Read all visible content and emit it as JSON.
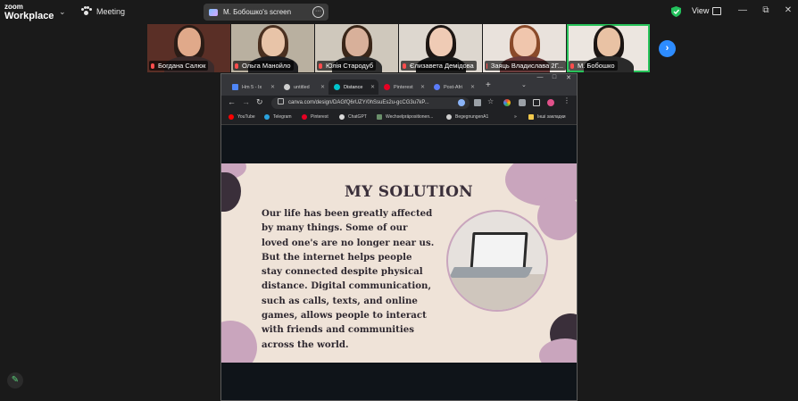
{
  "app": {
    "brand_top": "zoom",
    "brand_bottom": "Workplace",
    "meeting_label": "Meeting",
    "share_label": "M. Бобошко's screen",
    "view_label": "View"
  },
  "participants": [
    {
      "name": "Богдана Салюк",
      "skin": "#e0a98a",
      "hair": "#2b1c16",
      "bg": "#5a2f26",
      "shirt": "#3b2b2b"
    },
    {
      "name": "Ольга Манойло",
      "skin": "#e8c4a8",
      "hair": "#4a3020",
      "bg": "#b9b0a0",
      "shirt": "#1f1f22"
    },
    {
      "name": "Юлія Стародуб",
      "skin": "#d8b09a",
      "hair": "#3a2618",
      "bg": "#cfc8bc",
      "shirt": "#2c2c2c"
    },
    {
      "name": "Єлизавета Демідова",
      "skin": "#efcbb5",
      "hair": "#1d1613",
      "bg": "#ddd7cf",
      "shirt": "#1a1a1a"
    },
    {
      "name": "Заяць Владислава 2Г...",
      "skin": "#f0c6ad",
      "hair": "#8a4a2a",
      "bg": "#e9e2dc",
      "shirt": "#6b3b3b"
    },
    {
      "name": "М. Бобошко",
      "skin": "#e9c2a4",
      "hair": "#1b1513",
      "bg": "#ece6e0",
      "shirt": "#2a2a2a"
    }
  ],
  "browser": {
    "tabs": [
      "Hm 5 - Ix",
      "untitled",
      "Distance",
      "Pinterest",
      "Post-Afri"
    ],
    "url": "canva.com/design/DAGfQ6rUZY/0hSsuEs2u-gcCG3u7kP...",
    "bookmarks": [
      "YouTube",
      "Telegram",
      "Pinterest",
      "ChatGPT",
      "Wechselpräpositionen...",
      "BegegnungenA1",
      "Інші закладки"
    ]
  },
  "slide": {
    "title": "MY SOLUTION",
    "lines": [
      "Our life has been greatly affected",
      "by many things. Some of our",
      "loved one's are no longer near us.",
      "But the internet helps people",
      "stay connected despite physical",
      "distance. Digital communication,",
      "such as calls, texts, and online",
      "games, allows people to interact",
      "with friends and communities",
      "across the world."
    ]
  }
}
